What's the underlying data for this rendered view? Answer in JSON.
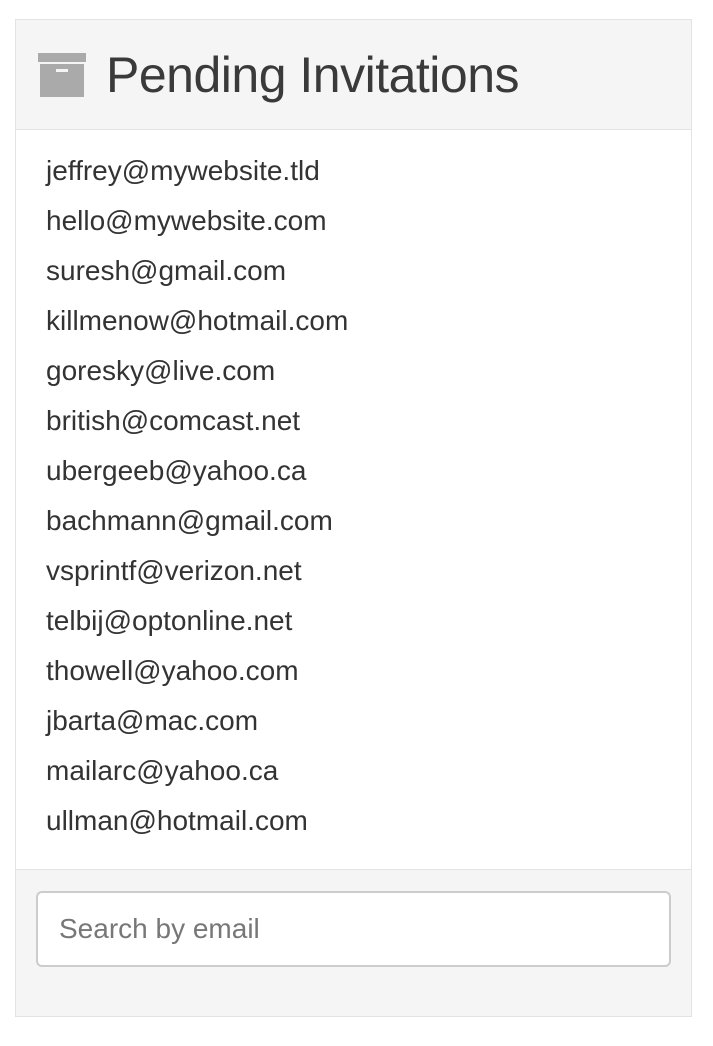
{
  "panel": {
    "title": "Pending Invitations",
    "icon": "archive-icon"
  },
  "invitations": [
    "jeffrey@mywebsite.tld",
    "hello@mywebsite.com",
    "suresh@gmail.com",
    "killmenow@hotmail.com",
    "goresky@live.com",
    "british@comcast.net",
    "ubergeeb@yahoo.ca",
    "bachmann@gmail.com",
    "vsprintf@verizon.net",
    "telbij@optonline.net",
    "thowell@yahoo.com",
    "jbarta@mac.com",
    "mailarc@yahoo.ca",
    "ullman@hotmail.com"
  ],
  "search": {
    "placeholder": "Search by email",
    "value": ""
  },
  "colors": {
    "header_bg": "#f5f5f5",
    "border": "#e3e3e3",
    "icon": "#aaaaaa",
    "text": "#333333"
  }
}
